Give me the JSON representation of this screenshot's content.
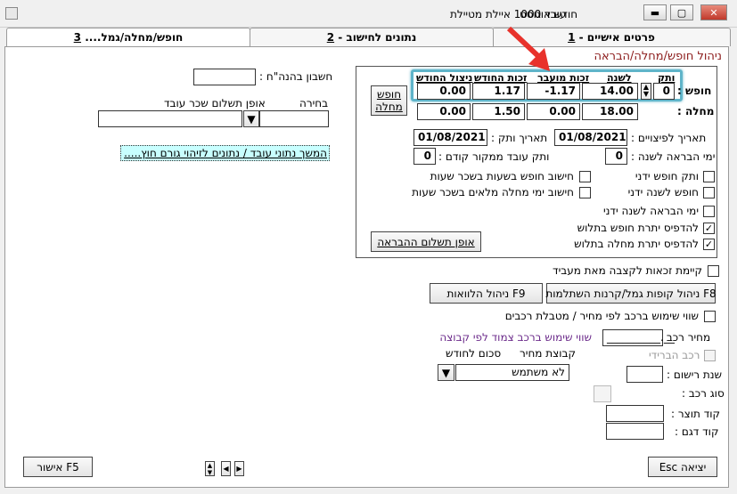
{
  "window": {
    "title_month": "חודש אוגוסט",
    "title_employee": "עובד 1000 איילת מטיילת"
  },
  "tabs": [
    {
      "label": "פרטים אישיים - ",
      "num": "1"
    },
    {
      "label": "נתונים לחישוב - ",
      "num": "2"
    },
    {
      "label": "חופש/מחלה/גמל.... ",
      "num": "3"
    }
  ],
  "section_title": "ניהול חופש/מחלה/הבראה",
  "grid": {
    "headers": {
      "seniority": "ותק",
      "per_year": "לשנה",
      "carried": "זכות מועבר",
      "monthly": "זכות החודש",
      "used": "ניצול החודש"
    },
    "vacation": {
      "label": "חופש :",
      "seniority": "0",
      "per_year": "14.00",
      "carried": "-1.17",
      "monthly": "1.17",
      "used": "0.00"
    },
    "sick": {
      "label": "מחלה :",
      "per_year": "18.00",
      "carried": "0.00",
      "monthly": "1.50",
      "used": "0.00"
    }
  },
  "vacation_sick_button": "חופש מחלה",
  "severance_date_label": "תאריך לפיצויים :",
  "severance_date": "01/08/2021",
  "seniority_date_label": "תאריך ותק :",
  "seniority_date": "01/08/2021",
  "recovery_days_label": "ימי הבראה לשנה :",
  "recovery_days": "0",
  "prev_source_label": "ותק עובד ממקור קודם :",
  "prev_source": "0",
  "checkboxes": {
    "manual_vacation_seniority": "ותק חופש ידני",
    "manual_vacation_year": "חופש לשנה ידני",
    "manual_recovery_days": "ימי הבראה לשנה ידני",
    "print_vacation_balance": "להדפיס יתרת חופש בתלוש",
    "print_sick_balance": "להדפיס יתרת מחלה בתלוש",
    "calc_vacation_hours": "חישוב חופש בשעות בשכר שעות",
    "calc_sick_full_days": "חישוב ימי מחלה מלאים בשכר שעות"
  },
  "recovery_payment_button": "אופן תשלום ההבראה",
  "recovery_payment_button_u": "ת",
  "bank_account_label": "חשבון בהנה\"ח :",
  "payment_method_label": "אופן תשלום שכר עובד",
  "choice_label": "בחירה",
  "continue_link": "המשך נתוני עובד / נתונים לזיהוי גורם חוץ.....",
  "transfer_rights_label": "קיימת זכאות לקצבה מאת מעביד",
  "f8_button": "F8 ניהול קופות גמל/קרנות השתלמות",
  "f9_button": "F9 ניהול הלוואות",
  "car_use_label": "שווי שימוש ברכב לפי מחיר / מטבלת רכבים",
  "car_price_label": "מחיר רכב :",
  "car_price_value": "__________.__",
  "hybrid_label": "רכב הברידי",
  "reg_year_label": "שנת רישום :",
  "car_type_label": "סוג רכב :",
  "manufacturer_code_label": "קוד תוצר :",
  "model_code_label": "קוד דגם :",
  "group_car_label": "שווי שימוש ברכב צמוד לפי קבוצה",
  "group_price_label": "קבוצת מחיר",
  "monthly_amount_label": "סכום לחודש",
  "not_used_value": "לא משתמש",
  "exit_button": "יציאה Esc",
  "approve_button": "F5 אישור",
  "colors": {
    "highlight": "#5fb4c9",
    "arrow": "#e8322b",
    "link_bg": "#c8ffff",
    "section_title": "#8b1a1a",
    "group_label": "#6b2a8a"
  }
}
